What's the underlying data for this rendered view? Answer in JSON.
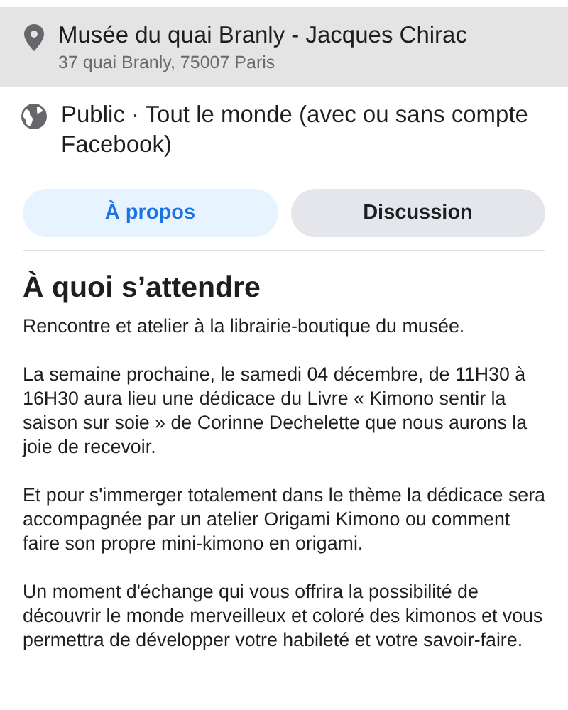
{
  "location": {
    "name": "Musée du quai Branly - Jacques Chirac",
    "address": "37 quai Branly, 75007 Paris"
  },
  "audience": {
    "text": "Public · Tout le monde (avec ou sans compte Facebook)"
  },
  "tabs": [
    {
      "label": "À propos",
      "selected": true
    },
    {
      "label": "Discussion",
      "selected": false
    }
  ],
  "section": {
    "title": "À quoi s’attendre",
    "paragraphs": [
      "Rencontre et atelier à la librairie-boutique du musée.",
      "La semaine prochaine, le samedi 04 décembre, de 11H30 à 16H30 aura lieu une dédicace du Livre « Kimono sentir la saison sur soie » de Corinne Dechelette que nous aurons la joie de recevoir.",
      "Et pour s'immerger totalement dans le thème la dédicace sera accompagnée par un atelier Origami Kimono ou comment faire son propre mini-kimono en origami.",
      "Un moment d'échange qui vous offrira la possibilité de découvrir le monde merveilleux et coloré des kimonos et vous permettra de développer votre habileté et votre savoir-faire."
    ]
  }
}
